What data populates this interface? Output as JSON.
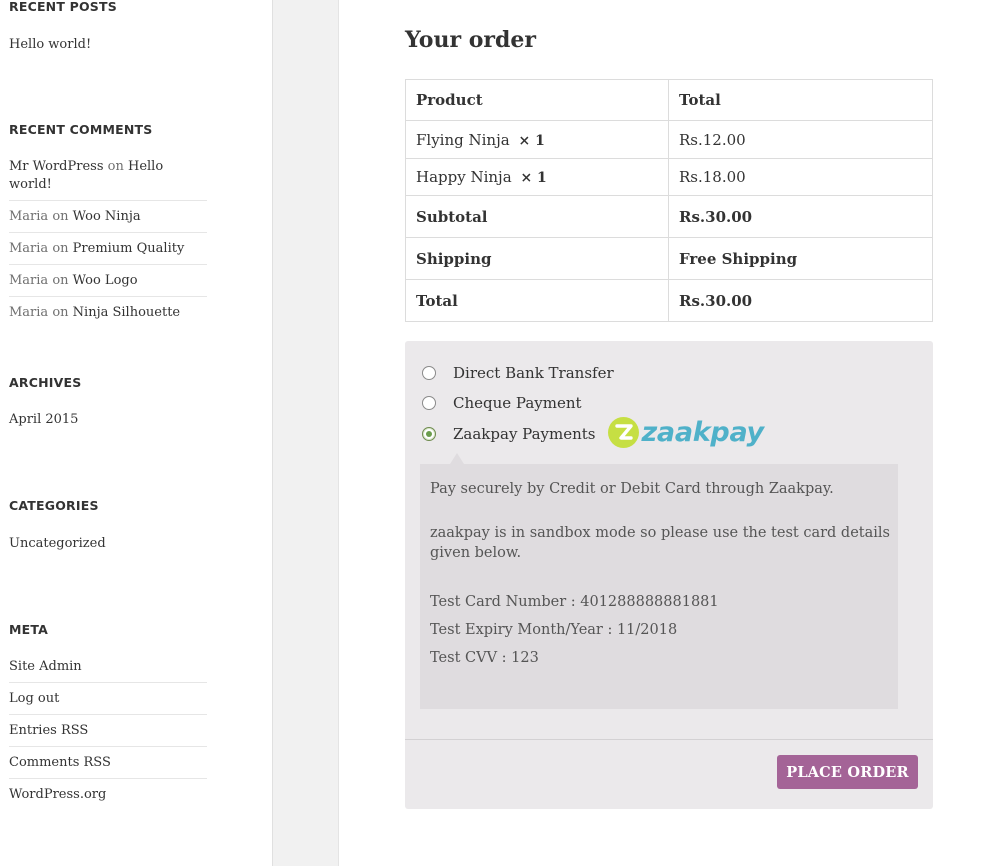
{
  "sidebar": {
    "recent_posts": {
      "title": "RECENT POSTS",
      "items": [
        "Hello world!"
      ]
    },
    "recent_comments": {
      "title": "RECENT COMMENTS",
      "items": [
        {
          "author": "Mr WordPress",
          "on": "on",
          "post": "Hello world!"
        },
        {
          "author": "Maria",
          "on": "on",
          "post": "Woo Ninja"
        },
        {
          "author": "Maria",
          "on": "on",
          "post": "Premium Quality"
        },
        {
          "author": "Maria",
          "on": "on",
          "post": "Woo Logo"
        },
        {
          "author": "Maria",
          "on": "on",
          "post": "Ninja Silhouette"
        }
      ]
    },
    "archives": {
      "title": "ARCHIVES",
      "items": [
        "April 2015"
      ]
    },
    "categories": {
      "title": "CATEGORIES",
      "items": [
        "Uncategorized"
      ]
    },
    "meta": {
      "title": "META",
      "items": [
        "Site Admin",
        "Log out",
        "Entries RSS",
        "Comments RSS",
        "WordPress.org"
      ]
    }
  },
  "order": {
    "title": "Your order",
    "headers": {
      "product": "Product",
      "total": "Total"
    },
    "items": [
      {
        "name": "Flying Ninja",
        "qty": "× 1",
        "total": "Rs.12.00"
      },
      {
        "name": "Happy Ninja",
        "qty": "× 1",
        "total": "Rs.18.00"
      }
    ],
    "subtotal": {
      "label": "Subtotal",
      "value": "Rs.30.00"
    },
    "shipping": {
      "label": "Shipping",
      "value": "Free Shipping"
    },
    "total": {
      "label": "Total",
      "value": "Rs.30.00"
    }
  },
  "payment": {
    "methods": [
      {
        "label": "Direct Bank Transfer",
        "selected": false
      },
      {
        "label": "Cheque Payment",
        "selected": false
      },
      {
        "label": "Zaakpay Payments",
        "selected": true,
        "logo_text": "zaakpay"
      }
    ],
    "description": {
      "line1": "Pay securely by Credit or Debit Card through Zaakpay.",
      "line2": "zaakpay is in sandbox mode so please use the test card details given below.",
      "card_number": "Test Card Number : 401288888881881",
      "expiry": "Test Expiry Month/Year : 11/2018",
      "cvv": "Test CVV : 123"
    },
    "place_order_label": "Place order",
    "colors": {
      "button": "#a46497",
      "logo_mark": "#c6df43",
      "logo_text": "#4fb1c9"
    }
  }
}
